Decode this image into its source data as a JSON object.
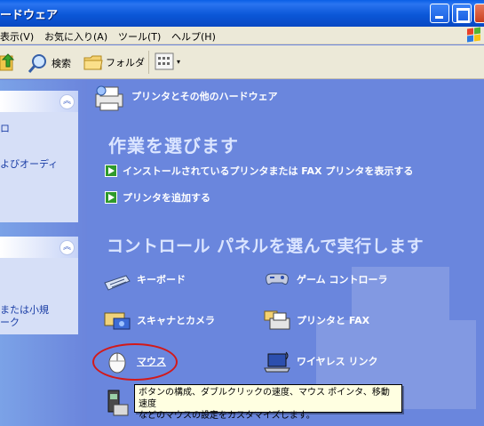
{
  "window": {
    "title": "ードウェア"
  },
  "menu": {
    "items": [
      "表示(V)",
      "お気に入り(A)",
      "ツール(T)",
      "ヘルプ(H)"
    ]
  },
  "toolbar": {
    "search_label": "検索",
    "folders_label": "フォルダ"
  },
  "left_panels": [
    {
      "lines": [
        "ロ",
        "よびオーディ"
      ]
    },
    {
      "lines": [
        "または小規",
        "ーク"
      ]
    }
  ],
  "main": {
    "category_title": "プリンタとその他のハードウェア",
    "task_heading": "作業を選びます",
    "tasks": [
      "インストールされているプリンタまたは FAX プリンタを表示する",
      "プリンタを追加する"
    ],
    "pick_heading": "コントロール パネルを選んで実行します",
    "items": [
      {
        "label": "キーボード",
        "icon": "keyboard-icon"
      },
      {
        "label": "ゲーム コントローラ",
        "icon": "game-controller-icon"
      },
      {
        "label": "スキャナとカメラ",
        "icon": "scanner-camera-icon"
      },
      {
        "label": "プリンタと FAX",
        "icon": "printer-fax-icon"
      },
      {
        "label": "マウス",
        "icon": "mouse-icon"
      },
      {
        "label": "ワイヤレス リンク",
        "icon": "wireless-link-icon"
      }
    ]
  },
  "tooltip": {
    "line1": "ボタンの構成、ダブルクリックの速度、マウス ポインタ、移動速度",
    "line2": "などのマウスの設定をカスタマイズします。"
  },
  "colors": {
    "titlebar": "#0b57d8",
    "main_bg": "#6a86dd",
    "highlight_circle": "#d31919",
    "tooltip_bg": "#ffffe1"
  }
}
